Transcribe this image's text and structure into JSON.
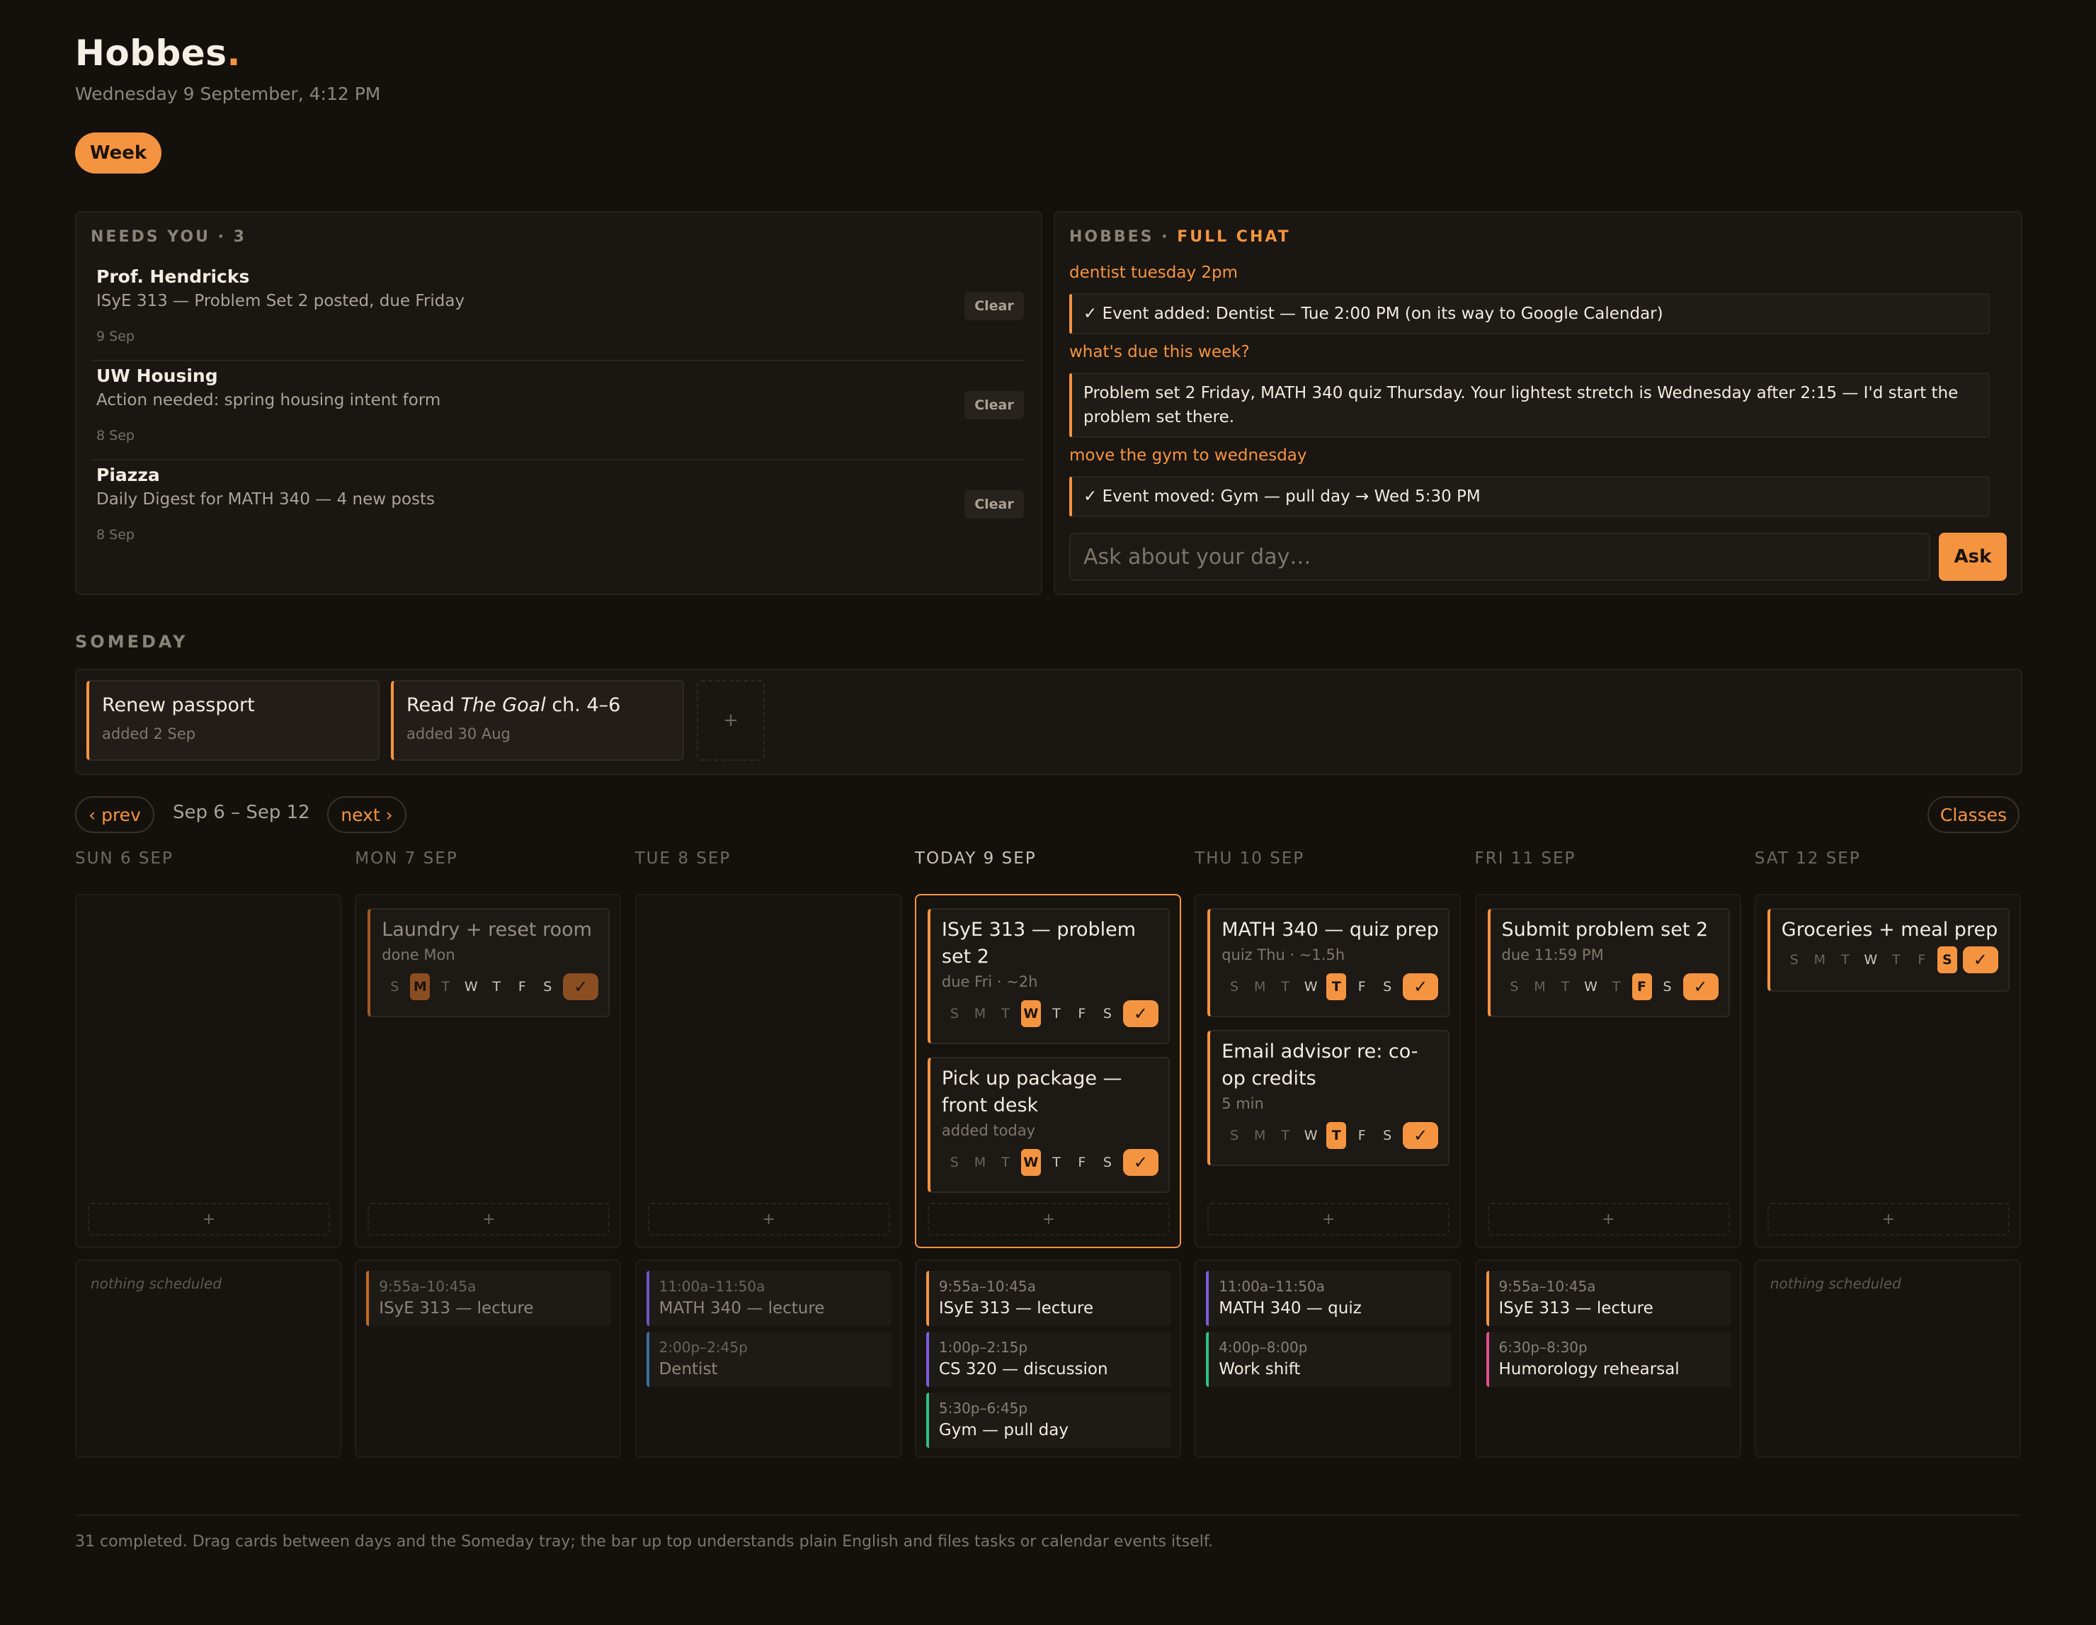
{
  "app": {
    "name": "Hobbes",
    "dot": ".",
    "datetime": "Wednesday 9 September, 4:12 PM",
    "view_label": "Week"
  },
  "needs_you": {
    "title": "NEEDS YOU · 3",
    "clear_label": "Clear",
    "items": [
      {
        "from": "Prof. Hendricks",
        "message": "ISyE 313 — Problem Set 2 posted, due Friday",
        "date": "9 Sep"
      },
      {
        "from": "UW Housing",
        "message": "Action needed: spring housing intent form",
        "date": "8 Sep"
      },
      {
        "from": "Piazza",
        "message": "Daily Digest for MATH 340 — 4 new posts",
        "date": "8 Sep"
      }
    ]
  },
  "chat": {
    "title": "HOBBES ·",
    "full_chat_link": "FULL CHAT",
    "messages": [
      {
        "q": "dentist tuesday 2pm",
        "a": "✓ Event added: Dentist — Tue 2:00 PM (on its way to Google Calendar)"
      },
      {
        "q": "what's due this week?",
        "a": "Problem set 2 Friday, MATH 340 quiz Thursday. Your lightest stretch is Wednesday after 2:15 — I'd start the problem set there."
      },
      {
        "q": "move the gym to wednesday",
        "a": "✓ Event moved: Gym — pull day → Wed 5:30 PM"
      }
    ],
    "input_placeholder": "Ask about your day…",
    "ask_label": "Ask"
  },
  "someday": {
    "title": "SOMEDAY",
    "items": [
      {
        "title": "Renew passport",
        "added": "added 2 Sep"
      },
      {
        "title_pre": "Read ",
        "title_em": "The Goal",
        "title_post": " ch. 4–6",
        "added": "added 30 Aug"
      }
    ],
    "add_label": "+"
  },
  "week": {
    "prev_label": "‹ prev",
    "next_label": "next ›",
    "range": "Sep 6 – Sep 12",
    "classes_label": "Classes",
    "add_label": "+",
    "weekday_letters": [
      "S",
      "M",
      "T",
      "W",
      "T",
      "F",
      "S"
    ],
    "check": "✓",
    "nothing_label": "nothing scheduled",
    "days": [
      {
        "header": "SUN 6 SEP",
        "tasks": [],
        "events": []
      },
      {
        "header": "MON 7 SEP",
        "tasks": [
          {
            "title": "Laundry + reset room",
            "meta": "done Mon"
          }
        ],
        "events": [
          {
            "time": "9:55a–10:45a",
            "name": "ISyE 313 — lecture"
          }
        ]
      },
      {
        "header": "TUE 8 SEP",
        "tasks": [],
        "events": [
          {
            "time": "11:00a–11:50a",
            "name": "MATH 340 — lecture"
          },
          {
            "time": "2:00p–2:45p",
            "name": "Dentist"
          }
        ]
      },
      {
        "header": "TODAY 9 SEP",
        "tasks": [
          {
            "title": "ISyE 313 — problem set 2",
            "meta": "due Fri · ~2h"
          },
          {
            "title": "Pick up package — front desk",
            "meta": "added today"
          }
        ],
        "events": [
          {
            "time": "9:55a–10:45a",
            "name": "ISyE 313 — lecture"
          },
          {
            "time": "1:00p–2:15p",
            "name": "CS 320 — discussion"
          },
          {
            "time": "5:30p–6:45p",
            "name": "Gym — pull day"
          }
        ]
      },
      {
        "header": "THU 10 SEP",
        "tasks": [
          {
            "title": "MATH 340 — quiz prep",
            "meta": "quiz Thu · ~1.5h"
          },
          {
            "title": "Email advisor re: co-op credits",
            "meta": "5 min"
          }
        ],
        "events": [
          {
            "time": "11:00a–11:50a",
            "name": "MATH 340 — quiz"
          },
          {
            "time": "4:00p–8:00p",
            "name": "Work shift"
          }
        ]
      },
      {
        "header": "FRI 11 SEP",
        "tasks": [
          {
            "title": "Submit problem set 2",
            "meta": "due 11:59 PM"
          }
        ],
        "events": [
          {
            "time": "9:55a–10:45a",
            "name": "ISyE 313 — lecture"
          },
          {
            "time": "6:30p–8:30p",
            "name": "Humorology rehearsal"
          }
        ]
      },
      {
        "header": "SAT 12 SEP",
        "tasks": [
          {
            "title": "Groceries + meal prep"
          }
        ],
        "events": []
      }
    ]
  },
  "colors": {
    "accent": "#f59440",
    "background": "#14110d",
    "event_purple": "#7b5ce0",
    "event_blue": "#3f7fb0",
    "event_green": "#2fbf8a",
    "event_pink": "#e0508f"
  },
  "footer": "31 completed. Drag cards between days and the Someday tray; the bar up top understands plain English and files tasks or calendar events itself."
}
